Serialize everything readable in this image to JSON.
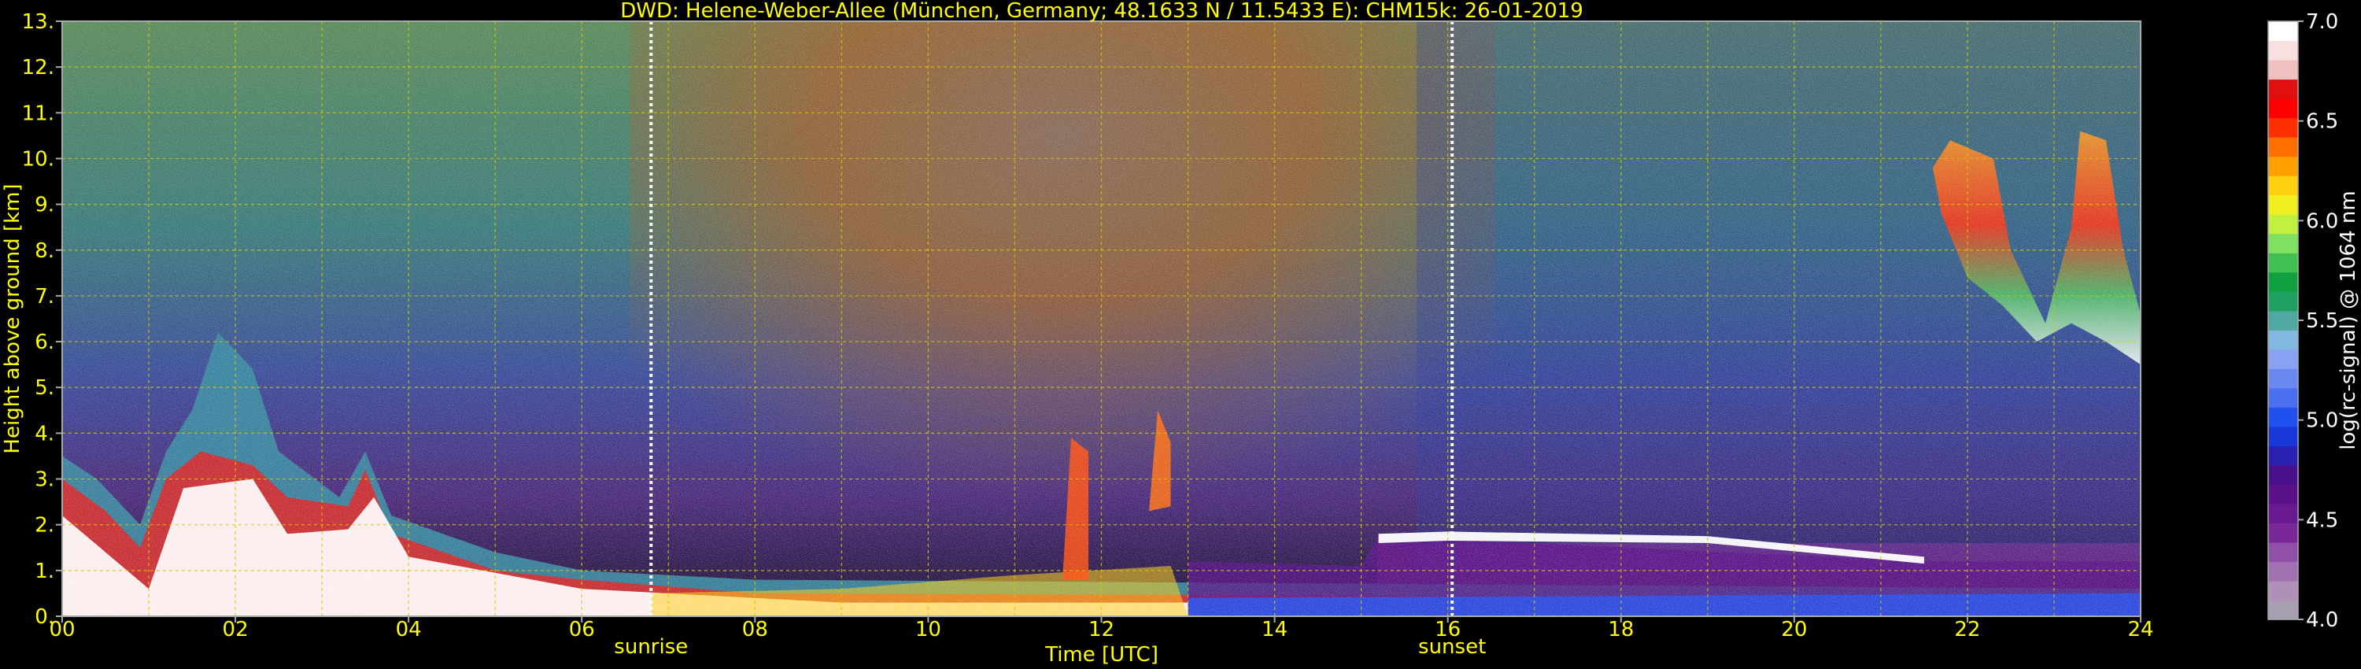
{
  "chart_data": {
    "type": "heatmap",
    "title": "DWD: Helene-Weber-Allee (München, Germany; 48.1633 N / 11.5433 E):    CHM15k: 26-01-2019",
    "xlabel": "Time [UTC]",
    "ylabel": "Height above ground [km]",
    "xlim": [
      0,
      24
    ],
    "ylim": [
      0,
      13
    ],
    "x_ticks": [
      "00",
      "02",
      "04",
      "06",
      "08",
      "10",
      "12",
      "14",
      "16",
      "18",
      "20",
      "22",
      "24"
    ],
    "y_ticks": [
      "0.",
      "1.",
      "2.",
      "3.",
      "4.",
      "5.",
      "6.",
      "7.",
      "8.",
      "9.",
      "10.",
      "11.",
      "12.",
      "13."
    ],
    "grid": true,
    "markers": [
      {
        "label": "sunrise",
        "x": 6.8
      },
      {
        "label": "sunset",
        "x": 16.05
      }
    ],
    "colorbar": {
      "label": "log(rc-signal) @ 1064 nm",
      "range": [
        4.0,
        7.0
      ],
      "ticks": [
        "4.0",
        "4.5",
        "5.0",
        "5.5",
        "6.0",
        "6.5",
        "7.0"
      ],
      "colors": [
        "#a8a0b0",
        "#b090b8",
        "#a070b0",
        "#9050a8",
        "#7a2898",
        "#6a1a90",
        "#5a1088",
        "#48108a",
        "#2a20b0",
        "#1838d8",
        "#2050f0",
        "#4a70f0",
        "#6a88f0",
        "#8aa0f0",
        "#80b8e0",
        "#50a8a0",
        "#20a060",
        "#10a040",
        "#40c050",
        "#80e060",
        "#c0f040",
        "#f0f020",
        "#ffd010",
        "#ffa000",
        "#ff7000",
        "#ff3000",
        "#ff0000",
        "#e01010",
        "#f0c0c0",
        "#f8e0e0",
        "#ffffff"
      ]
    },
    "regions": [
      {
        "name": "surface aerosol layer",
        "x": [
          0,
          16
        ],
        "y_base": [
          0.5,
          0.8
        ],
        "level": 6.8
      },
      {
        "name": "morning convective plume",
        "x": [
          1.2,
          2.5
        ],
        "y_top": 5.8,
        "level": 5.8
      },
      {
        "name": "stratiform low cloud",
        "x": [
          15.2,
          21.5
        ],
        "y": 1.65,
        "level": 7.0
      },
      {
        "name": "cirrus cloud",
        "x": [
          21.5,
          24
        ],
        "y": [
          5.5,
          11
        ],
        "level": 6.2
      }
    ]
  }
}
